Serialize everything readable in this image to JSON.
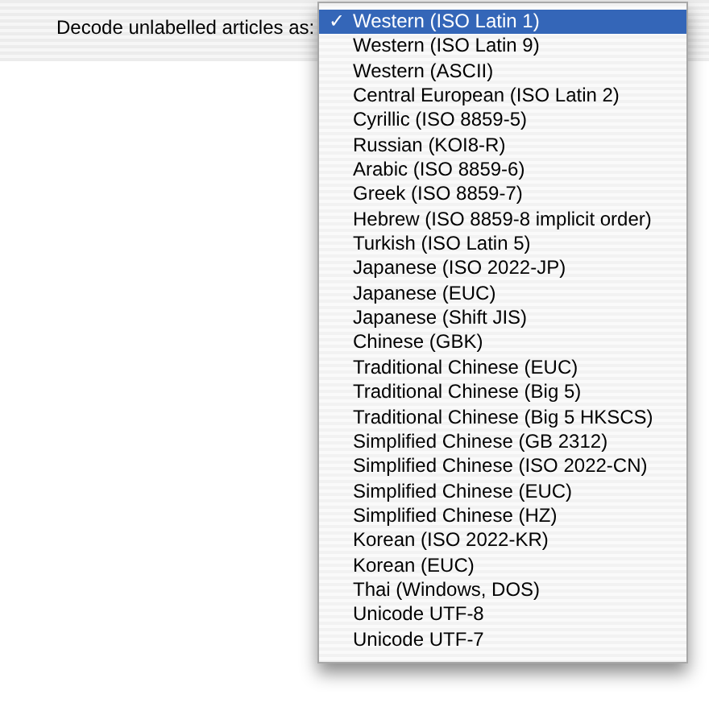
{
  "label": "Decode unlabelled articles as:",
  "menu": {
    "check_mark": "✓",
    "items": [
      {
        "label": "Western (ISO Latin 1)",
        "selected": true
      },
      {
        "label": "Western (ISO Latin 9)",
        "selected": false
      },
      {
        "label": "Western (ASCII)",
        "selected": false
      },
      {
        "label": "Central European (ISO Latin 2)",
        "selected": false
      },
      {
        "label": "Cyrillic (ISO 8859-5)",
        "selected": false
      },
      {
        "label": "Russian (KOI8-R)",
        "selected": false
      },
      {
        "label": "Arabic (ISO 8859-6)",
        "selected": false
      },
      {
        "label": "Greek (ISO 8859-7)",
        "selected": false
      },
      {
        "label": "Hebrew (ISO 8859-8 implicit order)",
        "selected": false
      },
      {
        "label": "Turkish (ISO Latin 5)",
        "selected": false
      },
      {
        "label": "Japanese (ISO 2022-JP)",
        "selected": false
      },
      {
        "label": "Japanese (EUC)",
        "selected": false
      },
      {
        "label": "Japanese (Shift JIS)",
        "selected": false
      },
      {
        "label": "Chinese (GBK)",
        "selected": false
      },
      {
        "label": "Traditional Chinese (EUC)",
        "selected": false
      },
      {
        "label": "Traditional Chinese (Big 5)",
        "selected": false
      },
      {
        "label": "Traditional Chinese (Big 5 HKSCS)",
        "selected": false
      },
      {
        "label": "Simplified Chinese (GB 2312)",
        "selected": false
      },
      {
        "label": "Simplified Chinese (ISO 2022-CN)",
        "selected": false
      },
      {
        "label": "Simplified Chinese (EUC)",
        "selected": false
      },
      {
        "label": "Simplified Chinese (HZ)",
        "selected": false
      },
      {
        "label": "Korean (ISO 2022-KR)",
        "selected": false
      },
      {
        "label": "Korean (EUC)",
        "selected": false
      },
      {
        "label": "Thai (Windows, DOS)",
        "selected": false
      },
      {
        "label": "Unicode UTF-8",
        "selected": false
      },
      {
        "label": "Unicode UTF-7",
        "selected": false
      }
    ]
  }
}
